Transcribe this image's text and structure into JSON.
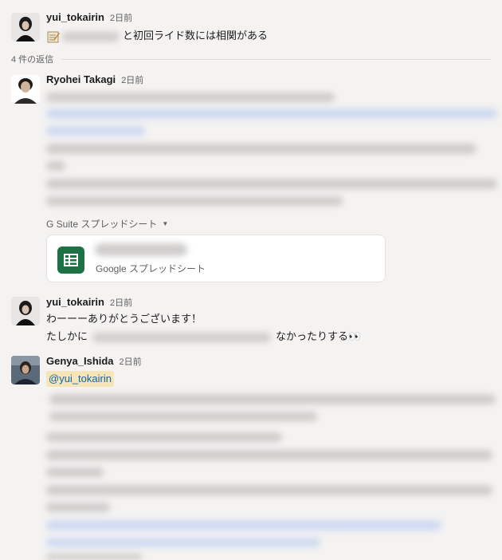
{
  "parent": {
    "author": "yui_tokairin",
    "time": "2日前",
    "text": "と初回ライド数には相関がある"
  },
  "replies_label": "4 件の返信",
  "reply1": {
    "author": "Ryohei Takagi",
    "time": "2日前",
    "attachment_section": "G Suite スプレッドシート",
    "attachment_type": "Google スプレッドシート"
  },
  "reply2": {
    "author": "yui_tokairin",
    "time": "2日前",
    "line1": "わーーーありがとうございます！",
    "line2_prefix": "たしかに",
    "line2_suffix": "なかったりする👀"
  },
  "reply3": {
    "author": "Genya_Ishida",
    "time": "2日前",
    "mention": "@yui_tokairin"
  },
  "colors": {
    "link": "#1264a3",
    "mention_bg": "#f6e5b7",
    "sheets_green": "#1e7145"
  },
  "icons": {
    "memo": "memo-icon",
    "sheets": "sheets-icon",
    "caret": "caret-down-icon"
  }
}
